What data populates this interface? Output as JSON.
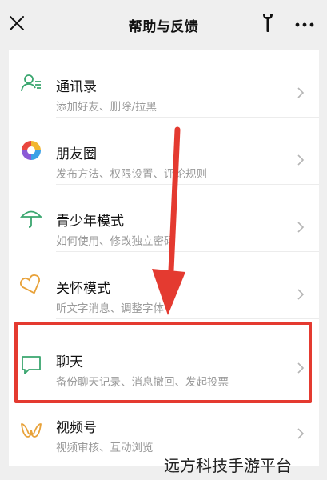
{
  "header": {
    "title": "帮助与反馈"
  },
  "items": [
    {
      "title": "通讯录",
      "subtitle": "添加好友、删除/拉黑",
      "icon": "contacts-icon"
    },
    {
      "title": "朋友圈",
      "subtitle": "发布方法、权限设置、评论规则",
      "icon": "moments-icon"
    },
    {
      "title": "青少年模式",
      "subtitle": "如何使用、修改独立密码",
      "icon": "umbrella-icon"
    },
    {
      "title": "关怀模式",
      "subtitle": "听文字消息、调整字体",
      "icon": "heart-icon"
    },
    {
      "title": "聊天",
      "subtitle": "备份聊天记录、消息撤回、发起投票",
      "icon": "chat-bubble-icon"
    },
    {
      "title": "视频号",
      "subtitle": "视频审核、互动浏览",
      "icon": "channels-icon"
    }
  ],
  "watermark": "远方科技手游平台",
  "colors": {
    "accent_green": "#3aa66f",
    "highlight_red": "#e43a30"
  }
}
